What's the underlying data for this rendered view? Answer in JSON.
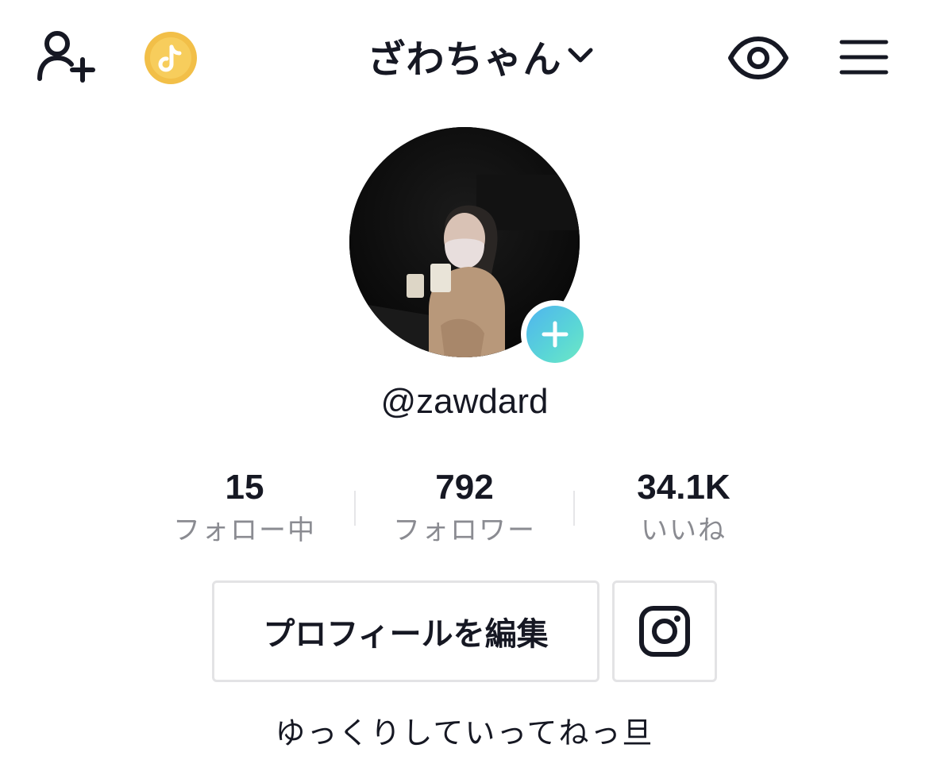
{
  "header": {
    "username": "ざわちゃん",
    "icons": {
      "add_friend": "add-user-icon",
      "coin": "tiktok-coin-icon",
      "switch": "chevron-down-icon",
      "view": "eye-icon",
      "menu": "hamburger-menu-icon"
    }
  },
  "profile": {
    "handle": "@zawdard",
    "avatar_add_icon": "plus-icon",
    "bio": "ゆっくりしていってねっ旦"
  },
  "stats": {
    "following": {
      "value": "15",
      "label": "フォロー中"
    },
    "followers": {
      "value": "792",
      "label": "フォロワー"
    },
    "likes": {
      "value": "34.1K",
      "label": "いいね"
    }
  },
  "actions": {
    "edit_profile": "プロフィールを編集",
    "instagram_icon": "instagram-icon"
  },
  "colors": {
    "text": "#161823",
    "secondary_text": "#8a8b91",
    "border": "#e3e3e5",
    "coin": "#f5c14a",
    "plus_gradient_start": "#4fb4ef",
    "plus_gradient_end": "#6ee8c4"
  }
}
